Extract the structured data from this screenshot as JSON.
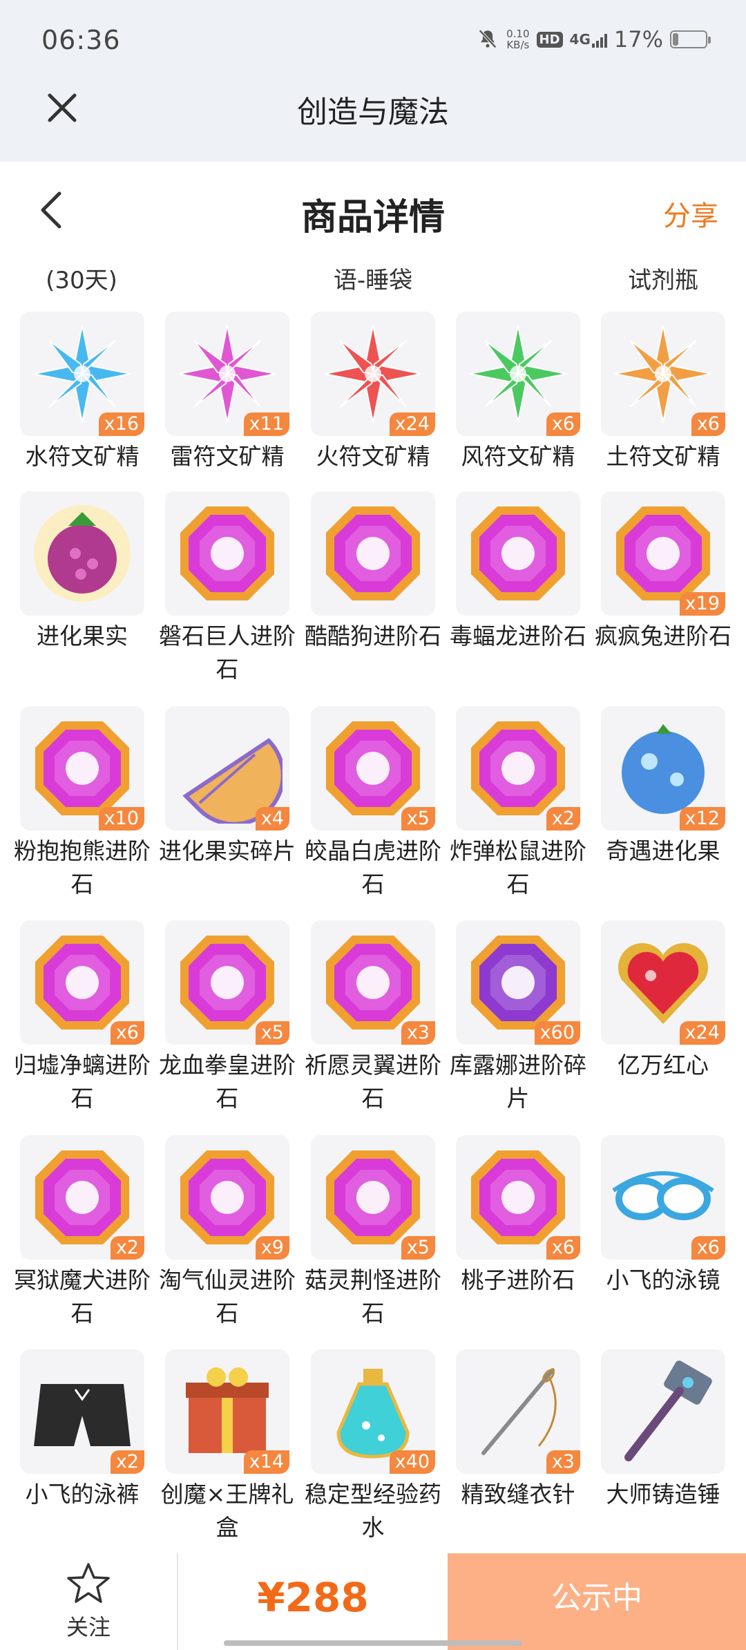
{
  "status_bar": {
    "time": "06:36",
    "net_speed_value": "0.10",
    "net_speed_unit": "KB/s",
    "hd_badge": "HD",
    "network": "4G",
    "battery_percent": "17%",
    "battery_level": 0.17
  },
  "app_bar": {
    "title": "创造与魔法"
  },
  "header": {
    "title": "商品详情",
    "share_label": "分享"
  },
  "overflow_labels": [
    "(30天)",
    "语-睡袋",
    "试剂瓶"
  ],
  "items": [
    {
      "name": "水符文矿精",
      "qty": "x16",
      "icon": "blue-crystal-icon",
      "color": "#3fb6f0"
    },
    {
      "name": "雷符文矿精",
      "qty": "x11",
      "icon": "purple-crystal-icon",
      "color": "#e04fd0"
    },
    {
      "name": "火符文矿精",
      "qty": "x24",
      "icon": "red-crystal-icon",
      "color": "#ee4a4a"
    },
    {
      "name": "风符文矿精",
      "qty": "x6",
      "icon": "green-crystal-icon",
      "color": "#43c75a"
    },
    {
      "name": "土符文矿精",
      "qty": "x6",
      "icon": "orange-crystal-icon",
      "color": "#f39a3a"
    },
    {
      "name": "进化果实",
      "qty": "",
      "icon": "evolution-fruit-icon",
      "color": "#b03a8e"
    },
    {
      "name": "磐石巨人进阶石",
      "qty": "",
      "icon": "advancement-stone-icon",
      "color": "#d93bd8"
    },
    {
      "name": "酷酷狗进阶石",
      "qty": "",
      "icon": "advancement-stone-icon",
      "color": "#d93bd8"
    },
    {
      "name": "毒蝠龙进阶石",
      "qty": "",
      "icon": "advancement-stone-icon",
      "color": "#d93bd8"
    },
    {
      "name": "疯疯兔进阶石",
      "qty": "x19",
      "icon": "advancement-stone-icon",
      "color": "#d93bd8"
    },
    {
      "name": "粉抱抱熊进阶石",
      "qty": "x10",
      "icon": "advancement-stone-icon",
      "color": "#d93bd8"
    },
    {
      "name": "进化果实碎片",
      "qty": "x4",
      "icon": "fruit-shard-icon",
      "color": "#f0b25a"
    },
    {
      "name": "皎晶白虎进阶石",
      "qty": "x5",
      "icon": "advancement-stone-icon",
      "color": "#d93bd8"
    },
    {
      "name": "炸弹松鼠进阶石",
      "qty": "x2",
      "icon": "advancement-stone-icon",
      "color": "#d93bd8"
    },
    {
      "name": "奇遇进化果",
      "qty": "x12",
      "icon": "blue-fruit-icon",
      "color": "#4a8fe0"
    },
    {
      "name": "归墟净螭进阶石",
      "qty": "x6",
      "icon": "advancement-stone-icon",
      "color": "#d93bd8"
    },
    {
      "name": "龙血拳皇进阶石",
      "qty": "x5",
      "icon": "advancement-stone-icon",
      "color": "#d93bd8"
    },
    {
      "name": "祈愿灵翼进阶石",
      "qty": "x3",
      "icon": "advancement-stone-icon",
      "color": "#d93bd8"
    },
    {
      "name": "库露娜进阶碎片",
      "qty": "x60",
      "icon": "advancement-shard-icon",
      "color": "#8e3ad0"
    },
    {
      "name": "亿万红心",
      "qty": "x24",
      "icon": "red-heart-gem-icon",
      "color": "#e0283c"
    },
    {
      "name": "冥狱魔犬进阶石",
      "qty": "x2",
      "icon": "advancement-stone-icon",
      "color": "#d93bd8"
    },
    {
      "name": "淘气仙灵进阶石",
      "qty": "x9",
      "icon": "advancement-stone-icon",
      "color": "#d93bd8"
    },
    {
      "name": "菇灵荆怪进阶石",
      "qty": "x5",
      "icon": "advancement-stone-icon",
      "color": "#d93bd8"
    },
    {
      "name": "桃子进阶石",
      "qty": "x6",
      "icon": "advancement-stone-icon",
      "color": "#d93bd8"
    },
    {
      "name": "小飞的泳镜",
      "qty": "x6",
      "icon": "swim-goggles-icon",
      "color": "#3aa7e0"
    },
    {
      "name": "小飞的泳裤",
      "qty": "x2",
      "icon": "swim-trunks-icon",
      "color": "#2b2b2b"
    },
    {
      "name": "创魔×王牌礼盒",
      "qty": "x14",
      "icon": "gift-box-icon",
      "color": "#d85a3a"
    },
    {
      "name": "稳定型经验药水",
      "qty": "x40",
      "icon": "potion-bottle-icon",
      "color": "#3fd0d8"
    },
    {
      "name": "精致缝衣针",
      "qty": "x3",
      "icon": "sewing-needle-icon",
      "color": "#8a8a8a"
    },
    {
      "name": "大师铸造锤",
      "qty": "",
      "icon": "forge-hammer-icon",
      "color": "#6a7a90"
    }
  ],
  "bottom_bar": {
    "follow_label": "关注",
    "price": "¥288",
    "buy_label": "公示中"
  }
}
